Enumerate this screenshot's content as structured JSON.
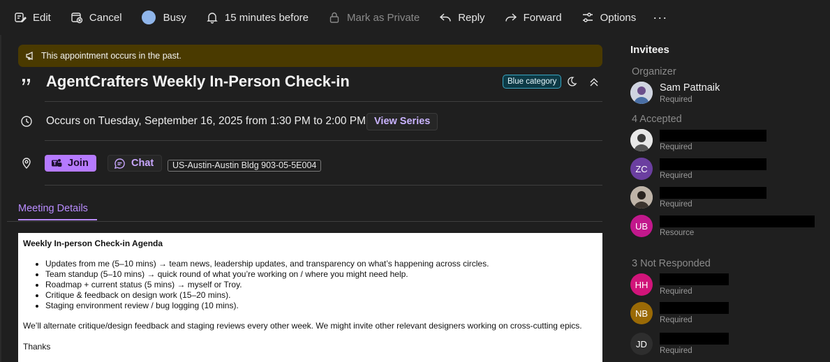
{
  "toolbar": {
    "edit": "Edit",
    "cancel": "Cancel",
    "status": "Busy",
    "status_color": "#8fb5ea",
    "reminder": "15 minutes before",
    "private": "Mark as Private",
    "reply": "Reply",
    "forward": "Forward",
    "options": "Options",
    "more": "···"
  },
  "banner": {
    "text": "This appointment occurs in the past.",
    "color": "#4a3a00"
  },
  "meeting": {
    "title": "AgentCrafters Weekly In-Person Check-in",
    "category": "Blue category",
    "occurs": "Occurs on Tuesday, September 16, 2025 from 1:30 PM to 2:00 PM",
    "view_series": "View Series",
    "join": "Join",
    "chat": "Chat",
    "location": "US-Austin-Austin Bldg 903-05-5E004"
  },
  "tab": {
    "label": "Meeting Details"
  },
  "body": {
    "heading": "Weekly In-person Check-in Agenda",
    "items": [
      "Updates from me (5–10 mins) → team news, leadership updates, and transparency on what’s happening across circles.",
      "Team standup (5–10 mins) → quick round of what you’re working on / where you might need help.",
      "Roadmap + current status (5 mins) → myself or Troy.",
      "Critique & feedback on design work (15–20 mins).",
      "Staging environment review / bug logging (10 mins)."
    ],
    "note": "We’ll alternate critique/design feedback and staging reviews every other week. We might invite other relevant designers working on cross-cutting epics.",
    "closing": "Thanks"
  },
  "invitees": {
    "title": "Invitees",
    "organizer_label": "Organizer",
    "organizer": {
      "name": "Sam Pattnaik",
      "role": "Required"
    },
    "accepted_label": "4 Accepted",
    "accepted": [
      {
        "initials": "",
        "role": "Required",
        "color": "#d9d9d9"
      },
      {
        "initials": "ZC",
        "role": "Required",
        "color": "#6b3fa0"
      },
      {
        "initials": "",
        "role": "Required",
        "color": "#5a4a3a"
      },
      {
        "initials": "UB",
        "role": "Resource",
        "color": "#c2188c"
      }
    ],
    "not_responded_label": "3 Not Responded",
    "not_responded": [
      {
        "initials": "HH",
        "role": "Required",
        "color": "#d1147a"
      },
      {
        "initials": "NB",
        "role": "Required",
        "color": "#9a6a06"
      },
      {
        "initials": "JD",
        "role": "Required",
        "color": "#2e2e2e"
      }
    ]
  }
}
